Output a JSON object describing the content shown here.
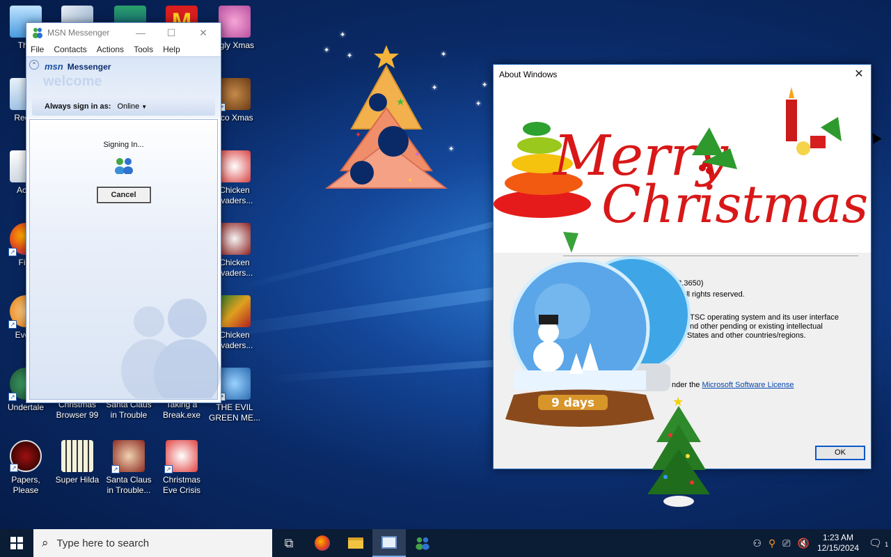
{
  "desktop": {
    "icons": [
      {
        "label": "This",
        "name": "this-pc"
      },
      {
        "label": "",
        "name": "photos"
      },
      {
        "label": "",
        "name": "game-character"
      },
      {
        "label": "",
        "name": "mcdonalds"
      },
      {
        "label": "ggly Xmas",
        "name": "piggly-xmas"
      },
      {
        "label": "Recyc",
        "name": "recycle-bin"
      },
      {
        "label": "oco Xmas",
        "name": "coco-xmas"
      },
      {
        "label": "Activ",
        "name": "activate"
      },
      {
        "label": "Chicken\nnvaders...",
        "name": "chicken-invaders-1"
      },
      {
        "label": "Fire",
        "name": "firefox"
      },
      {
        "label": "Chicken\nnvaders...",
        "name": "chicken-invaders-2"
      },
      {
        "label": "Every",
        "name": "everything"
      },
      {
        "label": "Chicken\nnvaders...",
        "name": "chicken-invaders-3"
      },
      {
        "label": "Undertale",
        "name": "undertale"
      },
      {
        "label": "Christmas\nBrowser 99",
        "name": "christmas-browser"
      },
      {
        "label": "Santa Claus\nin Trouble",
        "name": "santa-claus-trouble"
      },
      {
        "label": "Taking a\nBreak.exe",
        "name": "taking-a-break"
      },
      {
        "label": "THE EVIL\nGREEN ME...",
        "name": "evil-green"
      },
      {
        "label": "Papers,\nPlease",
        "name": "papers-please"
      },
      {
        "label": "Super Hilda",
        "name": "super-hilda"
      },
      {
        "label": "Santa Claus\nin Trouble...",
        "name": "santa-claus-trouble-2"
      },
      {
        "label": "Christmas\nEve Crisis",
        "name": "christmas-eve-crisis"
      }
    ]
  },
  "msn": {
    "title": "MSN Messenger",
    "menu": [
      "File",
      "Contacts",
      "Actions",
      "Tools",
      "Help"
    ],
    "logo": "msn",
    "logo_product": "Messenger",
    "welcome": "welcome",
    "always_sign_in_label": "Always sign in as:",
    "status": "Online",
    "signing_in": "Signing In...",
    "cancel": "Cancel"
  },
  "about": {
    "title": "About Windows",
    "banner_text_line1": "Merry",
    "banner_text_line2": "Christmas",
    "version_fragment": "763.3650)",
    "rights_fragment": "on. All rights reserved.",
    "tsc_line1": "TSC operating system and its user interface",
    "tsc_line2": "nd other pending or existing intellectual",
    "tsc_line3": "States and other countries/regions.",
    "license_prefix": "nder the",
    "license_link": "Microsoft Software License",
    "globe_label": "9 days",
    "ok": "OK"
  },
  "taskbar": {
    "search_placeholder": "Type here to search",
    "time": "1:23 AM",
    "date": "12/15/2024",
    "notification_count": "1"
  },
  "colors": {
    "taskbar": "#0b1c35",
    "accent": "#0b58c9",
    "msn_blue": "#1a4fa3",
    "merry_red": "#d81818"
  }
}
